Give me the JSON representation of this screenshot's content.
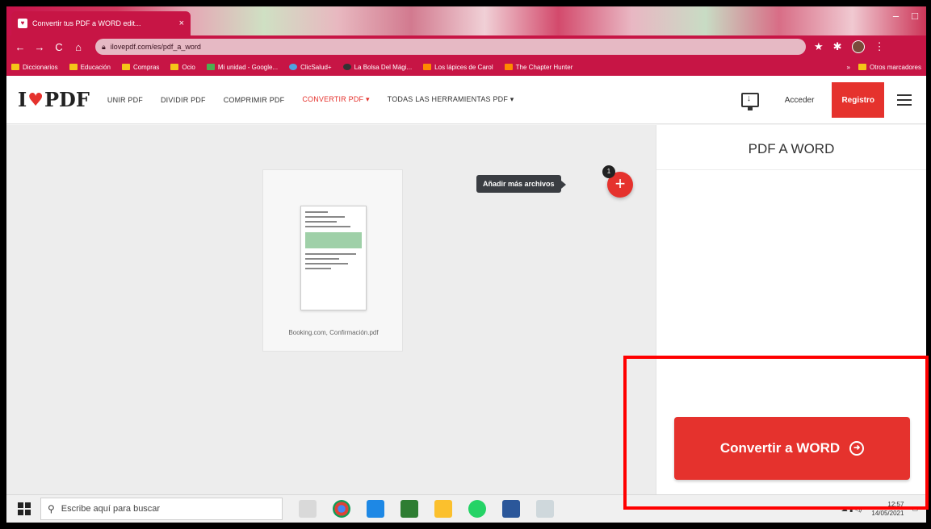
{
  "browser": {
    "tab_title": "Convertir tus PDF a WORD edit...",
    "tab_close": "×",
    "url": "ilovepdf.com/es/pdf_a_word",
    "bookmarks": [
      "Diccionarios",
      "Educación",
      "Compras",
      "Ocio",
      "Mi unidad - Google...",
      "ClicSalud+",
      "La Bolsa Del Mági...",
      "Los lápices de Carol",
      "The Chapter Hunter"
    ],
    "other_bookmarks": "Otros marcadores"
  },
  "site": {
    "logo_left": "I",
    "logo_right": "PDF",
    "nav": [
      "UNIR PDF",
      "DIVIDIR PDF",
      "COMPRIMIR PDF",
      "CONVERTIR PDF ▾",
      "TODAS LAS HERRAMIENTAS PDF ▾"
    ],
    "login": "Acceder",
    "register": "Registro"
  },
  "workspace": {
    "file_name": "Booking.com, Confirmación.pdf",
    "add_tooltip": "Añadir más archivos",
    "file_count": "1"
  },
  "sidebar": {
    "title": "PDF A WORD",
    "convert_label": "Convertir a WORD"
  },
  "taskbar": {
    "search_placeholder": "Escribe aquí para buscar",
    "time": "12:57",
    "date": "14/05/2021"
  },
  "colors": {
    "accent": "#e5322d",
    "browser_theme": "#c71545",
    "highlight": "#ff0000"
  }
}
